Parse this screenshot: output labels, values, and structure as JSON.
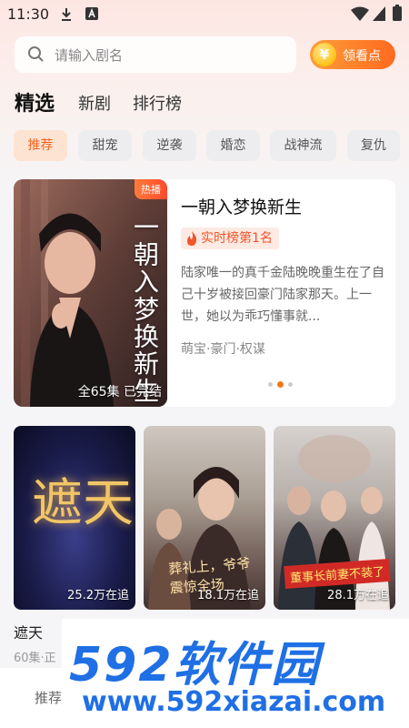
{
  "status_bar": {
    "time": "11:30"
  },
  "search": {
    "placeholder": "请输入剧名",
    "reward_label": "领看点",
    "coin_symbol": "¥"
  },
  "main_tabs": [
    {
      "label": "精选",
      "active": true
    },
    {
      "label": "新剧",
      "active": false
    },
    {
      "label": "排行榜",
      "active": false
    }
  ],
  "genres": [
    {
      "label": "推荐",
      "active": true
    },
    {
      "label": "甜宠",
      "active": false
    },
    {
      "label": "逆袭",
      "active": false
    },
    {
      "label": "婚恋",
      "active": false
    },
    {
      "label": "战神流",
      "active": false
    },
    {
      "label": "复仇",
      "active": false
    }
  ],
  "featured": {
    "badge": "热播",
    "poster_title": "一朝入梦换新生",
    "episodes": "全65集  已完结",
    "title": "一朝入梦换新生",
    "rank": "实时榜第1名",
    "description": "陆家唯一的真千金陆晚晚重生在了自己十岁被接回豪门陆家那天。上一世，她以为乖巧懂事就...",
    "tags": "萌宝·豪门·权谋",
    "carousel_index": 1,
    "carousel_count": 3
  },
  "dramas": [
    {
      "title": "遮天",
      "followers": "25.2万在追",
      "poster_text": "遮天",
      "meta": "60集·正"
    },
    {
      "title": "",
      "followers": "18.1万在追",
      "poster_text": "葬礼上，爷爷震惊全场"
    },
    {
      "title": "",
      "followers": "28.1万在追",
      "poster_text": "董事长前妻不装了"
    }
  ],
  "bottom_nav": {
    "first_label": "推荐"
  },
  "watermark": {
    "logo": "592软件园",
    "url": "www.592xiazai.com"
  },
  "colors": {
    "accent": "#f2631f",
    "rank": "#f1552a",
    "watermark": "#1f6fe5"
  }
}
